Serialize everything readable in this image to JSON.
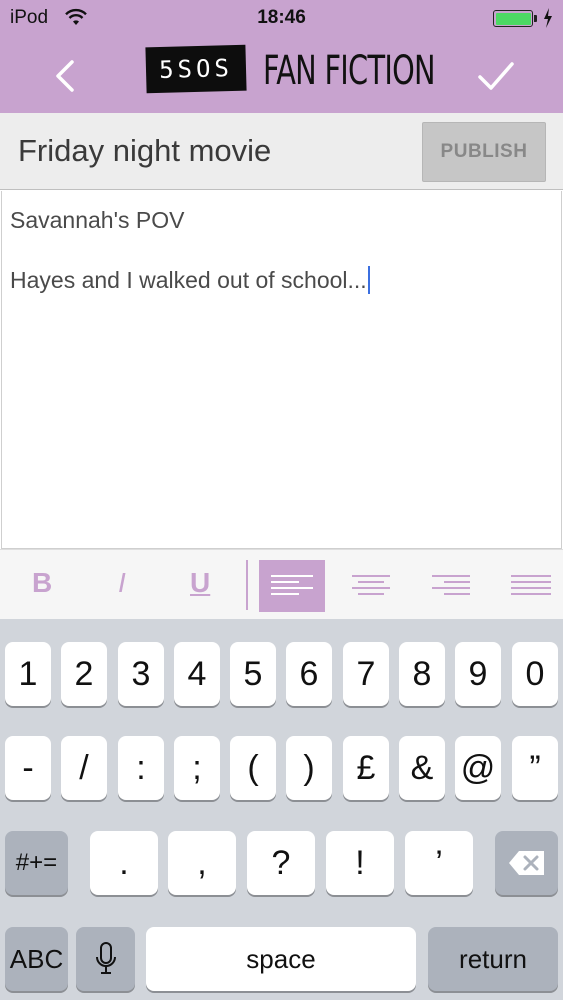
{
  "status_bar": {
    "carrier": "iPod",
    "time": "18:46",
    "battery_level": 1.0,
    "wifi_icon": "wifi-icon",
    "charging_icon": "bolt-icon"
  },
  "nav": {
    "back_icon": "chevron-left-icon",
    "done_icon": "checkmark-icon",
    "logo_badge": "5SOS",
    "logo_title": "FAN FICTION"
  },
  "title_row": {
    "title_value": "Friday night movie",
    "publish_label": "PUBLISH"
  },
  "editor": {
    "line1": "Savannah's POV",
    "line2": "Hayes and I walked out of school..."
  },
  "format_toolbar": {
    "bold": "B",
    "italic": "I",
    "underline": "U",
    "active_alignment": "left",
    "alignments": [
      "align-left-icon",
      "align-center-icon",
      "align-right-icon",
      "align-justify-icon"
    ]
  },
  "keyboard": {
    "row1": [
      "1",
      "2",
      "3",
      "4",
      "5",
      "6",
      "7",
      "8",
      "9",
      "0"
    ],
    "row2": [
      "-",
      "/",
      ":",
      ";",
      "(",
      ")",
      "£",
      "&",
      "@",
      "”"
    ],
    "row3_left": "#+=",
    "row3": [
      ".",
      ",",
      "?",
      "!",
      "’"
    ],
    "row3_right_icon": "backspace-icon",
    "row4_left": "ABC",
    "row4_mic_icon": "microphone-icon",
    "space": "space",
    "return": "return"
  },
  "colors": {
    "accent": "#c8a3cf",
    "keyboard_bg": "#d1d5db",
    "caret": "#3b6fe0",
    "battery": "#4cd964"
  }
}
